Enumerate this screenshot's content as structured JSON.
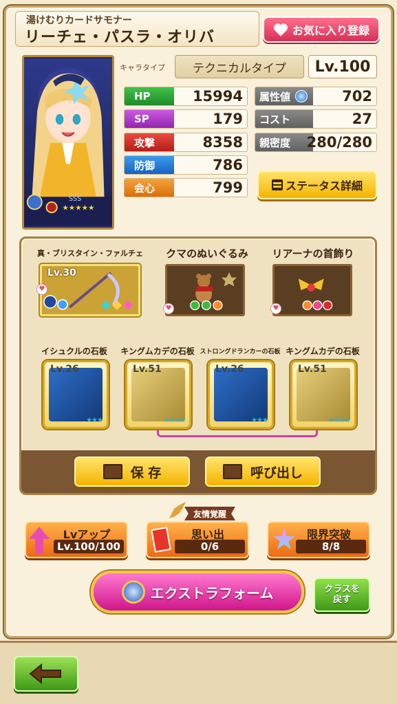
{
  "header": {
    "subtitle": "湯けむりカードサモナー",
    "name": "リーチェ・パスラ・オリバ",
    "favorite_label": "お気に入り登録"
  },
  "profile": {
    "type_label": "キャラタイプ",
    "type_value": "テクニカルタイプ",
    "level": "Lv.100"
  },
  "stats_left": [
    {
      "label": "HP",
      "value": "15994",
      "color": "#2fae3a"
    },
    {
      "label": "SP",
      "value": "179",
      "color": "#b63fd0"
    },
    {
      "label": "攻撃",
      "value": "8358",
      "color": "#d4302a"
    },
    {
      "label": "防御",
      "value": "786",
      "color": "#2a82d8"
    },
    {
      "label": "会心",
      "value": "799",
      "color": "#ef8a14"
    }
  ],
  "stats_right": [
    {
      "label": "属性値",
      "value": "702"
    },
    {
      "label": "コスト",
      "value": "27"
    },
    {
      "label": "親密度",
      "value": "280/280"
    }
  ],
  "status_detail_label": "ステータス詳細",
  "accessories": [
    {
      "name": "真・ブリスタイン・ファルチェ",
      "level": "Lv.30"
    },
    {
      "name": "クマのぬいぐるみ",
      "level": ""
    },
    {
      "name": "リアーナの首飾り",
      "level": ""
    }
  ],
  "slabs": [
    {
      "name": "イシュクルの石板",
      "level": "Lv.26",
      "stars": "★★★"
    },
    {
      "name": "キングムカデの石板",
      "level": "Lv.51",
      "stars": "★★★★"
    },
    {
      "name": "ストロングドランカーの石板",
      "level": "Lv.26",
      "stars": "★★★"
    },
    {
      "name": "キングムカデの石板",
      "level": "Lv.51",
      "stars": "★★★★"
    }
  ],
  "actions": {
    "save": "保 存",
    "load": "呼び出し"
  },
  "bottom": {
    "lvup_title": "Lvアップ",
    "lvup_value": "Lv.100/100",
    "bond_tag": "友情覚醒",
    "memory_title": "思い出",
    "memory_value": "0/6",
    "limit_title": "限界突破",
    "limit_value": "8/8",
    "extra_form": "エクストラフォーム",
    "class_back_line1": "クラスを",
    "class_back_line2": "戻す"
  }
}
